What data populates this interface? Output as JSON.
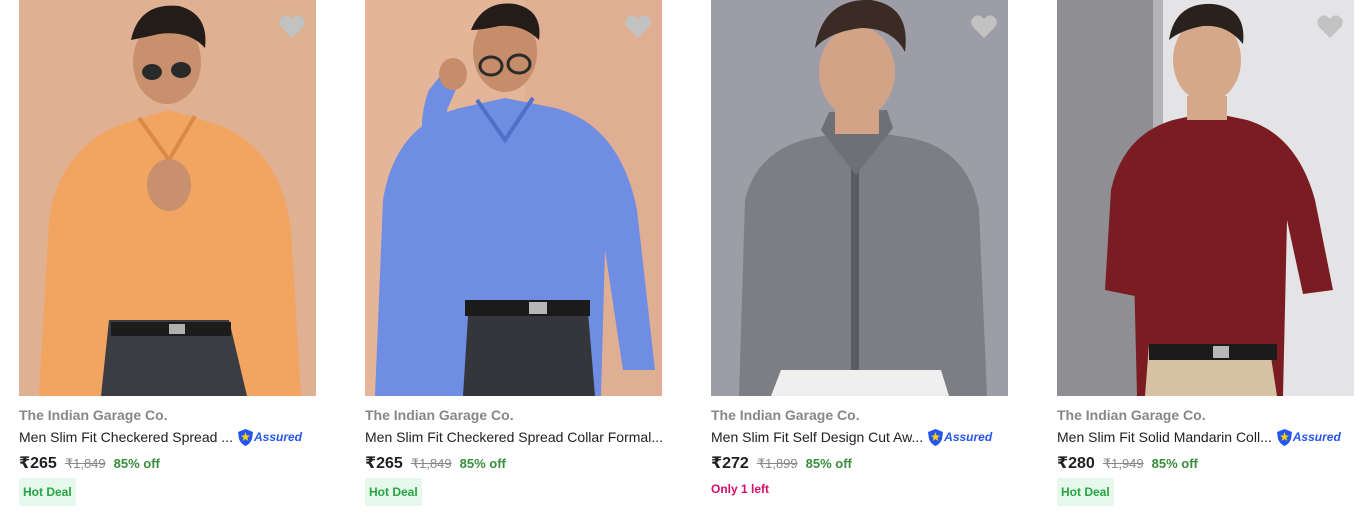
{
  "assured_label": "Assured",
  "colors": {
    "brand_text": "#878787",
    "title_text": "#212121",
    "discount_green": "#388e3c",
    "hot_deal_text": "#26a541",
    "hot_deal_bg": "#e5f8eb",
    "stock_alert": "#d60f68",
    "assured_blue": "#2455f4"
  },
  "products": [
    {
      "brand": "The Indian Garage Co.",
      "title": "Men Slim Fit Checkered Spread ...",
      "price": "₹265",
      "mrp": "₹1,849",
      "discount": "85% off",
      "badge": "Hot Deal",
      "assured": true,
      "shirt_color": "#f0a35e",
      "bg_color": "#e0b396",
      "icon": "heart-icon"
    },
    {
      "brand": "The Indian Garage Co.",
      "title": "Men Slim Fit Checkered Spread Collar Formal...",
      "price": "₹265",
      "mrp": "₹1,849",
      "discount": "85% off",
      "badge": "Hot Deal",
      "assured": false,
      "shirt_color": "#6c8be0",
      "bg_color": "#deae93",
      "icon": "heart-icon"
    },
    {
      "brand": "The Indian Garage Co.",
      "title": "Men Slim Fit Self Design Cut Aw...",
      "price": "₹272",
      "mrp": "₹1,899",
      "discount": "85% off",
      "stock_note": "Only 1 left",
      "assured": true,
      "shirt_color": "#7d7f84",
      "bg_color": "#9a9aa4",
      "icon": "heart-icon"
    },
    {
      "brand": "The Indian Garage Co.",
      "title": "Men Slim Fit Solid Mandarin Coll...",
      "price": "₹280",
      "mrp": "₹1,949",
      "discount": "85% off",
      "badge": "Hot Deal",
      "assured": true,
      "shirt_color": "#7b1c22",
      "bg_color": "#d6d6d8",
      "icon": "heart-icon"
    }
  ]
}
